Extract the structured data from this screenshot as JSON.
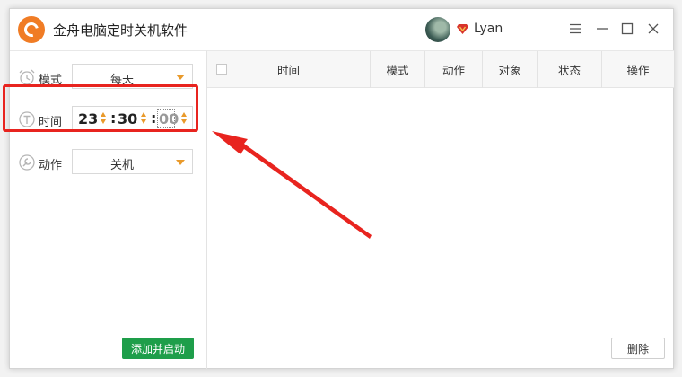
{
  "app": {
    "title": "金舟电脑定时关机软件",
    "username": "Lyan",
    "logo_icon": "app-logo-icon",
    "accent": "#f07c25"
  },
  "window_controls": {
    "menu_icon": "menu-icon",
    "minimize_icon": "minimize-icon",
    "maximize_icon": "maximize-icon",
    "close_icon": "close-icon"
  },
  "left_panel": {
    "mode": {
      "label": "模式",
      "value": "每天",
      "icon": "alarm-clock-icon"
    },
    "time": {
      "label": "时间",
      "hours": "23",
      "minutes": "30",
      "seconds": "00",
      "icon": "time-icon"
    },
    "action": {
      "label": "动作",
      "value": "关机",
      "icon": "wrench-icon"
    },
    "add_button": "添加并启动",
    "add_button_color": "#1e9e4a"
  },
  "table": {
    "columns": [
      "时间",
      "模式",
      "动作",
      "对象",
      "状态",
      "操作"
    ],
    "rows": []
  },
  "delete_button": "删除",
  "annotation_color": "#e8241f"
}
